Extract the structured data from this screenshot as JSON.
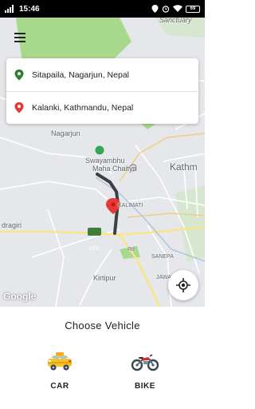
{
  "status_bar": {
    "time": "15:46",
    "battery": "69"
  },
  "map": {
    "labels": {
      "nagarjun": "Nagarjun",
      "swayambhu_line1": "Swayambhu",
      "swayambhu_line2": "Maha Chaitya",
      "kathmandu": "Kathm",
      "kalimati": "KALIMATI",
      "adrigiri": "dragiri",
      "h02": "H02",
      "sanepa": "SANEPA",
      "jawalakhel": "JAWALAKHEL",
      "kirtipur": "Kirtipur",
      "road_ring": "Rd",
      "shivapuri": "Sanctuary"
    },
    "google_logo": "Google"
  },
  "location": {
    "pickup": "Sitapaila, Nagarjun, Nepal",
    "destination": "Kalanki, Kathmandu, Nepal"
  },
  "sheet": {
    "title": "Choose Vehicle",
    "vehicles": [
      {
        "label": "CAR"
      },
      {
        "label": "BIKE"
      }
    ]
  },
  "colors": {
    "pickup_pin": "#2e7d32",
    "destination_pin": "#e53935",
    "route": "#3c4043",
    "park": "#a8d88b"
  }
}
